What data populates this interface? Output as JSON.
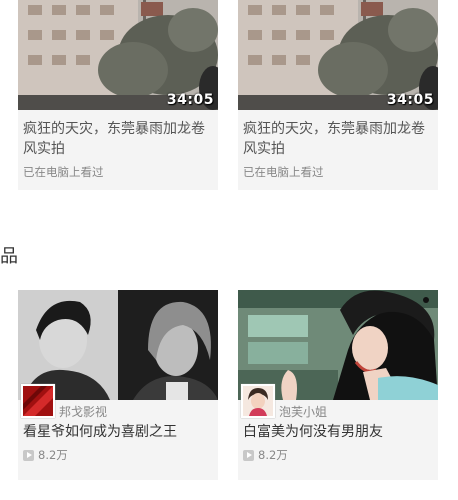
{
  "top_videos": [
    {
      "duration": "34:05",
      "title": "疯狂的天灾，东莞暴雨加龙卷风实拍",
      "status": "已在电脑上看过"
    },
    {
      "duration": "34:05",
      "title": "疯狂的天灾，东莞暴雨加龙卷风实拍",
      "status": "已在电脑上看过"
    }
  ],
  "section": {
    "label": "品"
  },
  "works": [
    {
      "uploader": "邦戈影视",
      "title": "看星爷如何成为喜剧之王",
      "views": "8.2万"
    },
    {
      "uploader": "泡芙小姐",
      "title": "白富美为何没有男朋友",
      "views": "8.2万"
    }
  ]
}
